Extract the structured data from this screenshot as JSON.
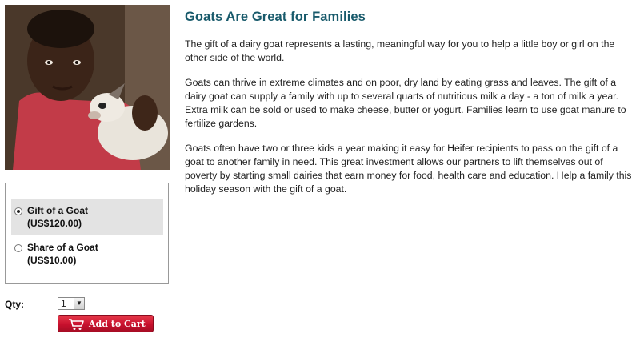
{
  "product": {
    "title": "Goats Are Great for Families",
    "paragraphs": [
      "The gift of a dairy goat represents a lasting, meaningful way for you to help a little boy or girl on the other side of the world.",
      "Goats can thrive in extreme climates and on poor, dry land by eating grass and leaves. The gift of a dairy goat can supply a family with up to several quarts of nutritious milk a day - a ton of milk a year. Extra milk can be sold or used to make cheese, butter or yogurt. Families learn to use goat manure to fertilize gardens.",
      "Goats often have two or three kids a year making it easy for Heifer recipients to pass on the gift of a goat to another family in need. This great investment allows our partners to lift themselves out of poverty by starting small dairies that earn money for food, health care and education. Help a family this holiday season with the gift of a goat."
    ]
  },
  "options": [
    {
      "name": "Gift of a Goat",
      "price": "(US$120.00)",
      "selected": true
    },
    {
      "name": "Share of a Goat",
      "price": "(US$10.00)",
      "selected": false
    }
  ],
  "qty": {
    "label": "Qty:",
    "value": "1"
  },
  "cart": {
    "label": "Add to Cart"
  },
  "icons": {
    "cart": "shopping-cart-icon",
    "dropdown": "chevron-down-icon"
  },
  "colors": {
    "title": "#185a6b",
    "button": "#c8102e",
    "selected_option_bg": "#e3e3e3"
  }
}
